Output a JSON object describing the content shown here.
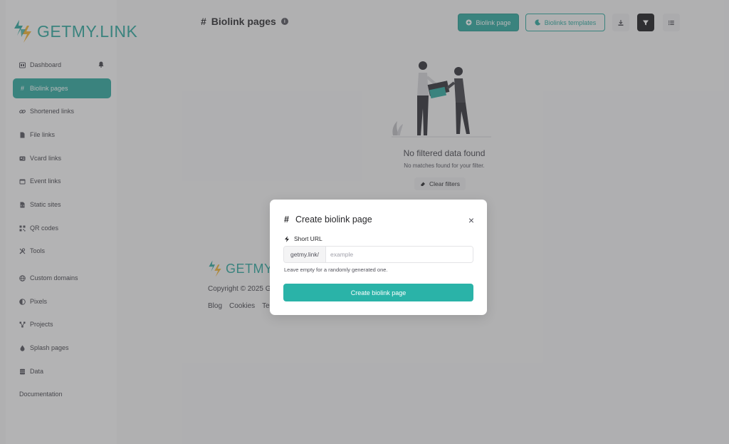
{
  "brand": {
    "name": "GETMY.LINK",
    "accent": "#2aa89d",
    "accent_light": "#2ab3a8",
    "yellow": "#f2b230"
  },
  "sidebar": {
    "items": [
      {
        "label": "Dashboard",
        "icon": "dashboard-icon"
      },
      {
        "label": "Biolink pages",
        "icon": "hash-icon",
        "active": true
      },
      {
        "label": "Shortened links",
        "icon": "link-icon"
      },
      {
        "label": "File links",
        "icon": "file-icon"
      },
      {
        "label": "Vcard links",
        "icon": "id-card-icon"
      },
      {
        "label": "Event links",
        "icon": "calendar-icon"
      },
      {
        "label": "Static sites",
        "icon": "file-code-icon"
      },
      {
        "label": "QR codes",
        "icon": "qrcode-icon"
      },
      {
        "label": "Tools",
        "icon": "tools-icon"
      },
      {
        "label": "Custom domains",
        "icon": "globe-icon"
      },
      {
        "label": "Pixels",
        "icon": "adjust-icon"
      },
      {
        "label": "Projects",
        "icon": "project-diagram-icon"
      },
      {
        "label": "Splash pages",
        "icon": "droplet-icon"
      },
      {
        "label": "Data",
        "icon": "database-icon"
      },
      {
        "label": "Documentation",
        "icon": ""
      }
    ]
  },
  "header": {
    "title_symbol": "#",
    "title": "Biolink pages",
    "info_symbol": "i",
    "create_button": "Biolink page",
    "templates_button": "Biolinks templates"
  },
  "empty_state": {
    "title": "No filtered data found",
    "subtitle": "No matches found for your filter.",
    "clear_button": "Clear filters"
  },
  "footer": {
    "logo_text": "GETMY.L",
    "copyright": "Copyright © 2025 G",
    "links": [
      "Blog",
      "Cookies",
      "Ter"
    ]
  },
  "modal": {
    "title_symbol": "#",
    "title": "Create biolink page",
    "close_symbol": "×",
    "field_label": "Short URL",
    "prefix": "getmy.link/",
    "placeholder": "example",
    "value": "",
    "help": "Leave empty for a randomly generated one.",
    "submit": "Create biolink page"
  }
}
